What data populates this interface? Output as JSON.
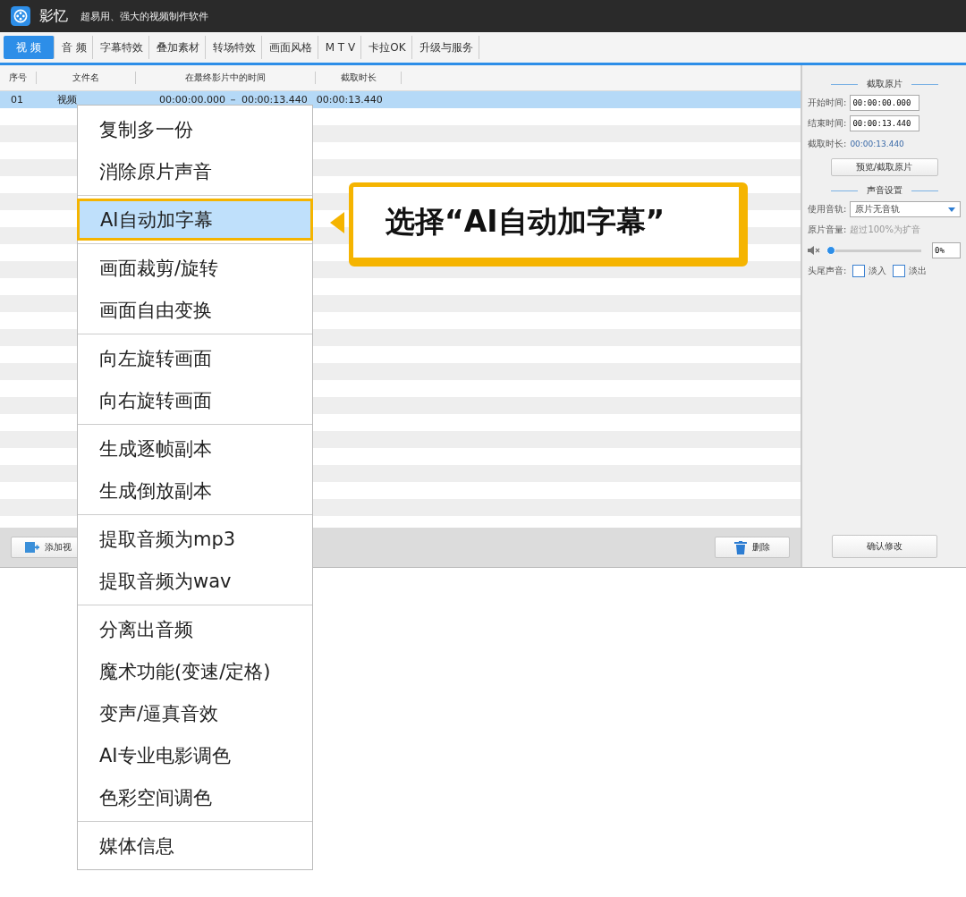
{
  "window": {
    "app_name": "影忆",
    "subtitle": "超易用、强大的视频制作软件"
  },
  "tabs": [
    {
      "label": "视 频",
      "selected": true
    },
    {
      "label": "音 频",
      "selected": false
    },
    {
      "label": "字幕特效",
      "selected": false
    },
    {
      "label": "叠加素材",
      "selected": false
    },
    {
      "label": "转场特效",
      "selected": false
    },
    {
      "label": "画面风格",
      "selected": false
    },
    {
      "label": "M T V",
      "selected": false
    },
    {
      "label": "卡拉OK",
      "selected": false
    },
    {
      "label": "升级与服务",
      "selected": false
    }
  ],
  "table": {
    "columns": [
      "序号",
      "文件名",
      "在最终影片中的时间",
      "截取时长"
    ],
    "rows": [
      {
        "cells": [
          "01",
          "视频",
          "00:00:00.000 － 00:00:13.440",
          "00:00:13.440"
        ],
        "selected": true
      }
    ]
  },
  "bottom_bar": {
    "add_button": "添加视",
    "delete_button": "删除"
  },
  "side_panel": {
    "clip_title": "截取原片",
    "start_label": "开始时间:",
    "start_value": "00:00:00.000",
    "end_label": "结束时间:",
    "end_value": "00:00:13.440",
    "duration_label": "截取时长:",
    "duration_value": "00:00:13.440",
    "preview_button": "预览/截取原片",
    "sound_title": "声音设置",
    "track_label": "使用音轨:",
    "track_value": "原片无音轨",
    "volume_label": "原片音量:",
    "volume_hint": "超过100%为扩音",
    "volume": {
      "level": 0.0,
      "value": "0%"
    },
    "fade_label": "头尾声音:",
    "fades": [
      {
        "label": "淡入",
        "checked": false
      },
      {
        "label": "淡出",
        "checked": false
      }
    ],
    "confirm_button": "确认修改"
  },
  "context_menu": {
    "groups": [
      [
        {
          "label": "复制多一份",
          "selected": false
        },
        {
          "label": "消除原片声音",
          "selected": false
        }
      ],
      [
        {
          "label": "AI自动加字幕",
          "selected": true
        }
      ],
      [
        {
          "label": "画面裁剪/旋转",
          "selected": false
        },
        {
          "label": "画面自由变换",
          "selected": false
        }
      ],
      [
        {
          "label": "向左旋转画面",
          "selected": false
        },
        {
          "label": "向右旋转画面",
          "selected": false
        }
      ],
      [
        {
          "label": "生成逐帧副本",
          "selected": false
        },
        {
          "label": "生成倒放副本",
          "selected": false
        }
      ],
      [
        {
          "label": "提取音频为mp3",
          "selected": false
        },
        {
          "label": "提取音频为wav",
          "selected": false
        }
      ],
      [
        {
          "label": "分离出音频",
          "selected": false
        },
        {
          "label": "魔术功能(变速/定格)",
          "selected": false
        },
        {
          "label": "变声/逼真音效",
          "selected": false
        },
        {
          "label": "AI专业电影调色",
          "selected": false
        },
        {
          "label": "色彩空间调色",
          "selected": false
        }
      ],
      [
        {
          "label": "媒体信息",
          "selected": false
        }
      ]
    ]
  },
  "callout": {
    "text": "选择“AI自动加字幕”"
  }
}
